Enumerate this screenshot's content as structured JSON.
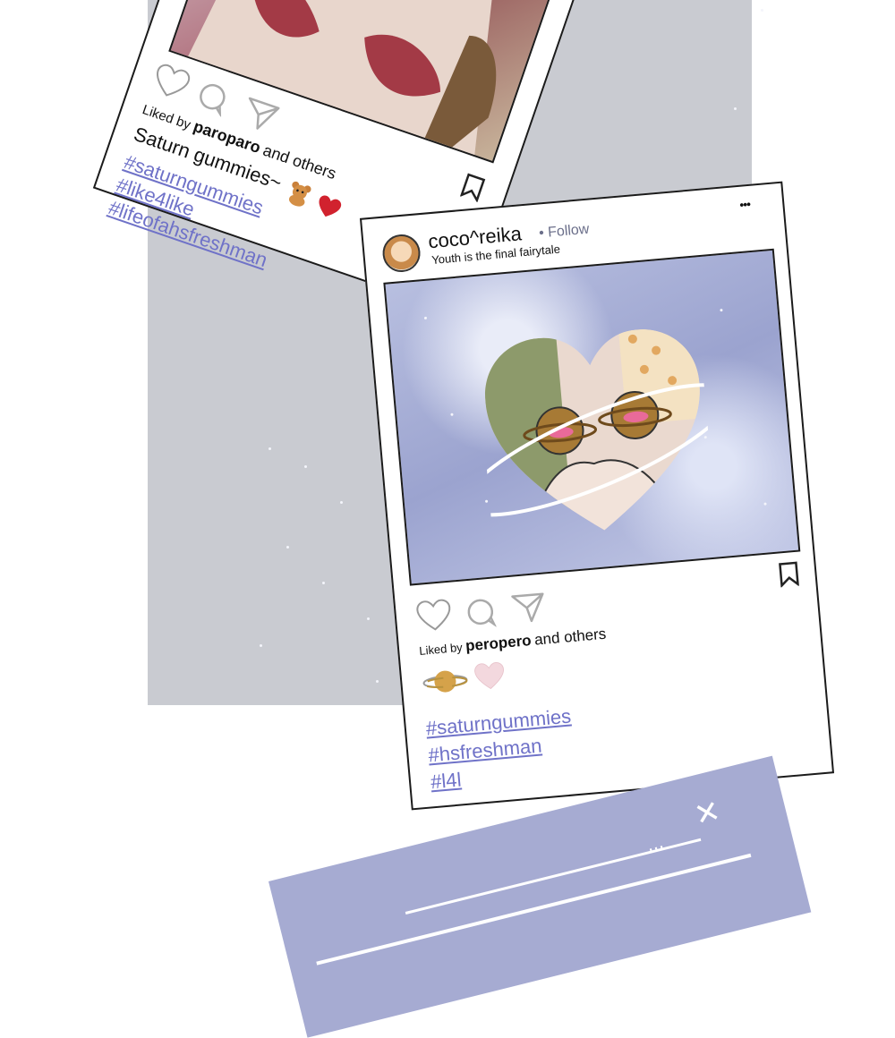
{
  "background": {
    "panel_color": "#c9cbd1",
    "page_color": "#ffffff"
  },
  "post_top": {
    "liked_by_prefix": "Liked by",
    "liked_by_user": "paroparo",
    "liked_by_suffix": "and others",
    "caption": "Saturn gummies~",
    "hashtags": [
      "#saturngummies",
      "#like4like",
      "#lifeofahsfreshman"
    ],
    "icons": [
      "heart-icon",
      "comment-icon",
      "share-icon",
      "bookmark-icon"
    ]
  },
  "post_main": {
    "username": "coco^reika",
    "follow_label": "• Follow",
    "subtitle": "Youth is the final fairytale",
    "menu_glyph": "•••",
    "liked_by_prefix": "Liked by",
    "liked_by_user": "peropero",
    "liked_by_suffix": "and others",
    "hashtags": [
      "#saturngummies",
      "#hsfreshman",
      "#l4l"
    ],
    "accent_color": "#6f72c8",
    "icons": [
      "heart-icon",
      "comment-icon",
      "share-icon",
      "bookmark-icon",
      "more-options-icon"
    ]
  },
  "bottom_panel": {
    "color": "#a6abd2",
    "close_glyph": "✕",
    "dots_glyph": "..."
  }
}
